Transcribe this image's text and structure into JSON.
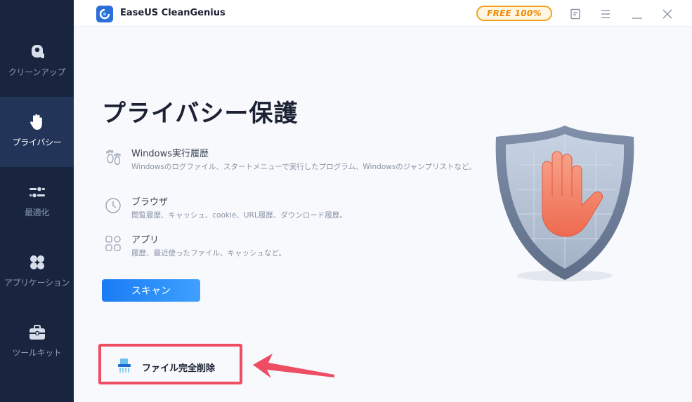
{
  "app": {
    "title": "EaseUS CleanGenius",
    "badge": "FREE 100%"
  },
  "sidebar": {
    "items": [
      {
        "label": "クリーンアップ",
        "icon": "vacuum-icon",
        "active": false
      },
      {
        "label": "プライバシー",
        "icon": "hand-icon",
        "active": true
      },
      {
        "label": "最適化",
        "icon": "sliders-icon",
        "active": false
      },
      {
        "label": "アプリケーション",
        "icon": "apps-icon",
        "active": false
      },
      {
        "label": "ツールキット",
        "icon": "toolbox-icon",
        "active": false
      }
    ]
  },
  "main": {
    "title": "プライバシー保護",
    "features": [
      {
        "title": "Windows実行履歴",
        "desc": "Windowsのログファイル、スタートメニューで実行したプログラム、Windowsのジャンプリストなど。",
        "icon": "footprints-icon"
      },
      {
        "title": "ブラウザ",
        "desc": "閲覧履歴、キャッシュ、cookie、URL履歴、ダウンロード履歴。",
        "icon": "clock-icon"
      },
      {
        "title": "アプリ",
        "desc": "履歴、最近使ったファイル、キャッシュなど。",
        "icon": "apps-outline-icon"
      }
    ],
    "scan_label": "スキャン",
    "shred_label": "ファイル完全削除"
  },
  "colors": {
    "sidebar_bg": "#19253f",
    "sidebar_active": "#223558",
    "accent": "#1a7cf5",
    "badge": "#f3a21c",
    "highlight": "#ee4d63"
  }
}
